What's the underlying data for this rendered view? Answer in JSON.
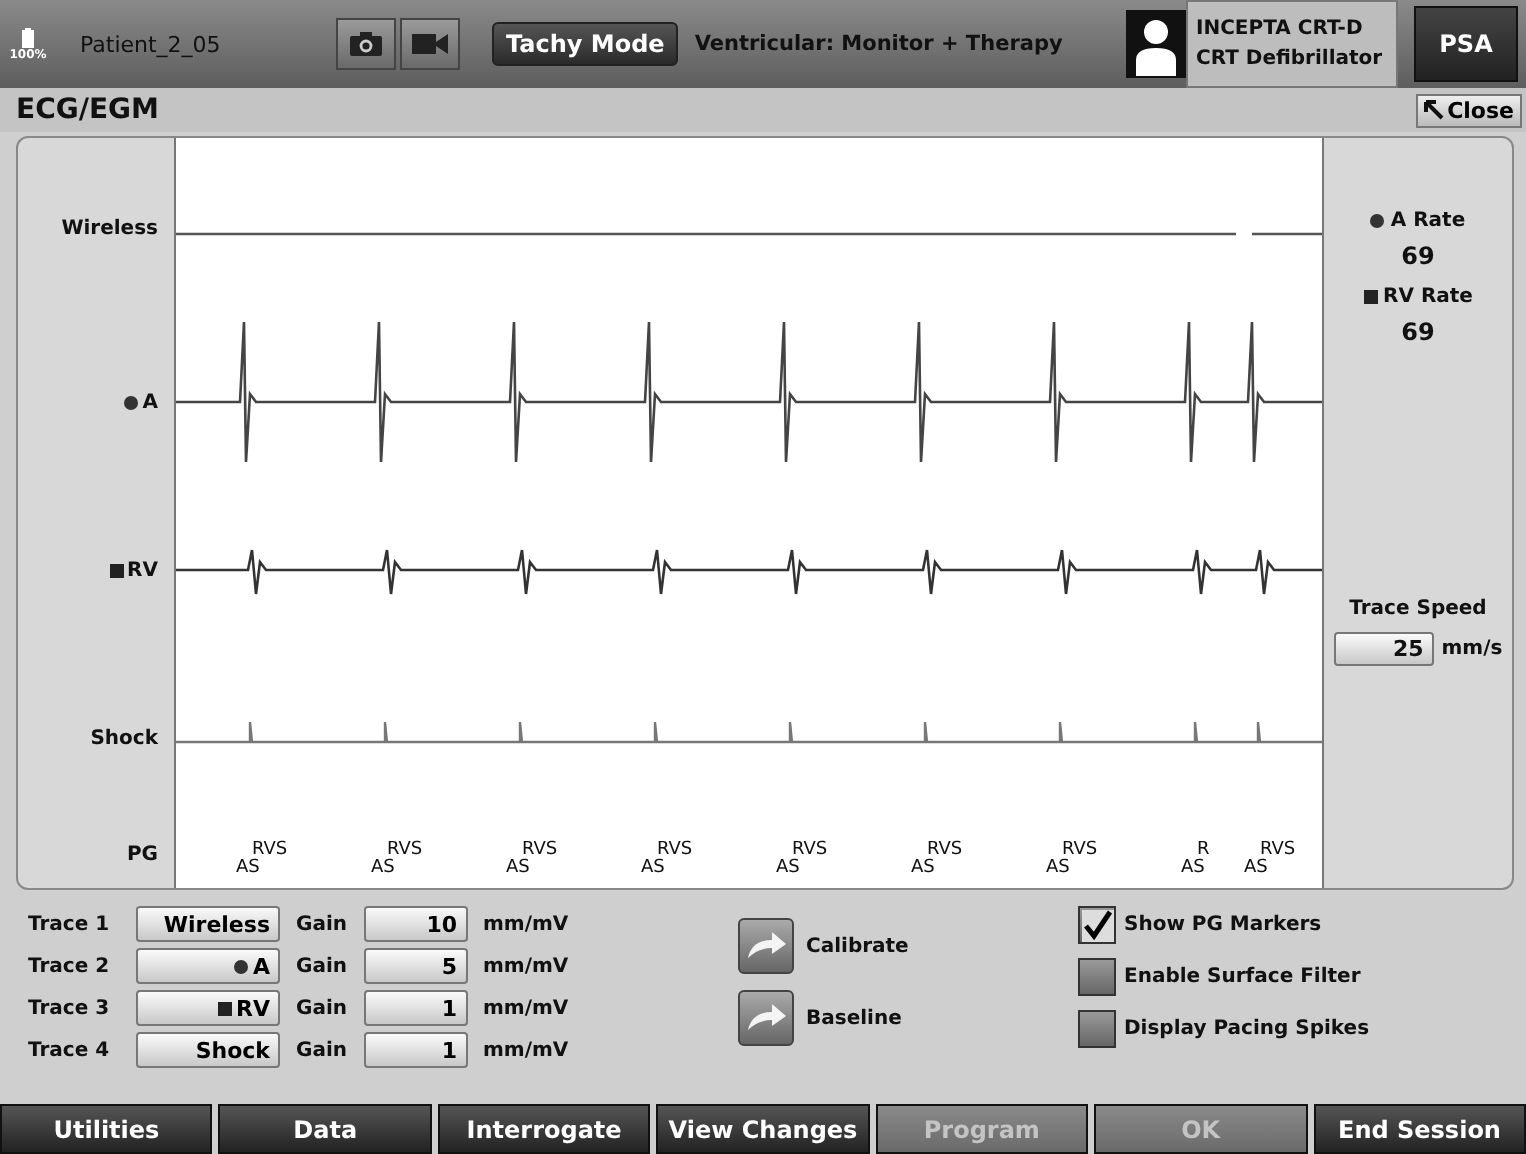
{
  "header": {
    "battery": "100%",
    "patient": "Patient_2_05",
    "mode_button": "Tachy Mode",
    "mode_status": "Ventricular: Monitor + Therapy",
    "device_model": "INCEPTA CRT-D",
    "device_type": "CRT Defibrillator",
    "psa_button": "PSA"
  },
  "panel": {
    "title": "ECG/EGM",
    "close_button": "Close"
  },
  "trace_labels": [
    {
      "kind": "plain",
      "label": "Wireless"
    },
    {
      "kind": "dot",
      "label": "A"
    },
    {
      "kind": "square",
      "label": "RV"
    },
    {
      "kind": "plain",
      "label": "Shock"
    },
    {
      "kind": "plain",
      "label": "PG"
    }
  ],
  "markers": [
    {
      "top": "RVS",
      "bottom": "AS"
    },
    {
      "top": "RVS",
      "bottom": "AS"
    },
    {
      "top": "RVS",
      "bottom": "AS"
    },
    {
      "top": "RVS",
      "bottom": "AS"
    },
    {
      "top": "RVS",
      "bottom": "AS"
    },
    {
      "top": "RVS",
      "bottom": "AS"
    },
    {
      "top": "RVS",
      "bottom": "AS"
    },
    {
      "top": "R",
      "bottom": "AS"
    },
    {
      "top": "RVS",
      "bottom": "AS"
    }
  ],
  "rates": [
    {
      "kind": "dot",
      "label": "A Rate",
      "value": "69"
    },
    {
      "kind": "square",
      "label": "RV Rate",
      "value": "69"
    }
  ],
  "trace_speed": {
    "label": "Trace Speed",
    "value": "25",
    "unit": "mm/s"
  },
  "traces": [
    {
      "label": "Trace 1",
      "kind": "plain",
      "source": "Wireless",
      "gain_label": "Gain",
      "gain": "10",
      "unit": "mm/mV"
    },
    {
      "label": "Trace 2",
      "kind": "dot",
      "source": "A",
      "gain_label": "Gain",
      "gain": "5",
      "unit": "mm/mV"
    },
    {
      "label": "Trace 3",
      "kind": "square",
      "source": "RV",
      "gain_label": "Gain",
      "gain": "1",
      "unit": "mm/mV"
    },
    {
      "label": "Trace 4",
      "kind": "plain",
      "source": "Shock",
      "gain_label": "Gain",
      "gain": "1",
      "unit": "mm/mV"
    }
  ],
  "actions": [
    "Calibrate",
    "Baseline"
  ],
  "options": [
    {
      "label": "Show PG Markers",
      "checked": true
    },
    {
      "label": "Enable Surface Filter",
      "checked": false
    },
    {
      "label": "Display Pacing Spikes",
      "checked": false
    }
  ],
  "nav_buttons": [
    {
      "label": "Utilities",
      "disabled": false
    },
    {
      "label": "Data",
      "disabled": false
    },
    {
      "label": "Interrogate",
      "disabled": false
    },
    {
      "label": "View Changes",
      "disabled": false
    },
    {
      "label": "Program",
      "disabled": true
    },
    {
      "label": "OK",
      "disabled": true
    },
    {
      "label": "End Session",
      "disabled": false
    }
  ]
}
